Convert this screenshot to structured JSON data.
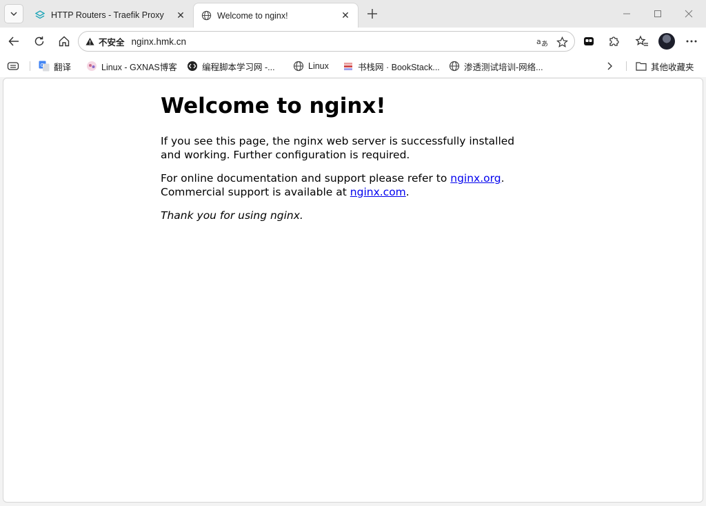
{
  "tabs": [
    {
      "title": "HTTP Routers - Traefik Proxy",
      "favicon": "traefik-icon",
      "active": false
    },
    {
      "title": "Welcome to nginx!",
      "favicon": "globe-icon",
      "active": true
    }
  ],
  "address_bar": {
    "security_label": "不安全",
    "url": "nginx.hmk.cn"
  },
  "bookmarks": [
    {
      "label": "翻译",
      "icon": "google-translate-icon"
    },
    {
      "label": "Linux - GXNAS博客",
      "icon": "gxnas-icon"
    },
    {
      "label": "编程脚本学习网 -...",
      "icon": "code-icon"
    },
    {
      "label": "Linux",
      "icon": "globe-icon"
    },
    {
      "label": "书栈网 · BookStack...",
      "icon": "bookstack-icon"
    },
    {
      "label": "渗透测试培训-网络...",
      "icon": "globe-icon"
    }
  ],
  "other_bookmarks": "其他收藏夹",
  "page": {
    "heading": "Welcome to nginx!",
    "para1": "If you see this page, the nginx web server is successfully installed and working. Further configuration is required.",
    "para2_prefix": "For online documentation and support please refer to ",
    "link1": "nginx.org",
    "para2_mid": ".",
    "para2_line2": "Commercial support is available at ",
    "link2": "nginx.com",
    "para2_end": ".",
    "thanks": "Thank you for using nginx."
  }
}
